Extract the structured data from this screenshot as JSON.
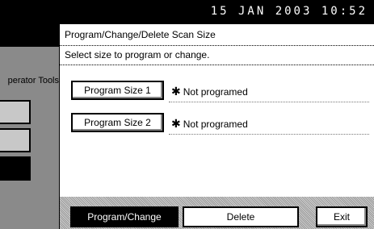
{
  "header": {
    "datetime": "15 JAN  2003 10:52"
  },
  "sidebar": {
    "label": "perator Tools"
  },
  "panel": {
    "title": "Program/Change/Delete Scan Size",
    "instruction": "Select size to program or change.",
    "programs": [
      {
        "label": "Program Size 1",
        "status_star": "✱",
        "status": "Not programed"
      },
      {
        "label": "Program Size 2",
        "status_star": "✱",
        "status": "Not programed"
      }
    ]
  },
  "actions": {
    "program_change": "Program/Change",
    "delete": "Delete",
    "exit": "Exit"
  },
  "colors": {
    "background": "#ffffff",
    "topbar": "#000000",
    "sidebar": "#8a8a8a",
    "selected_button": "#000000"
  }
}
